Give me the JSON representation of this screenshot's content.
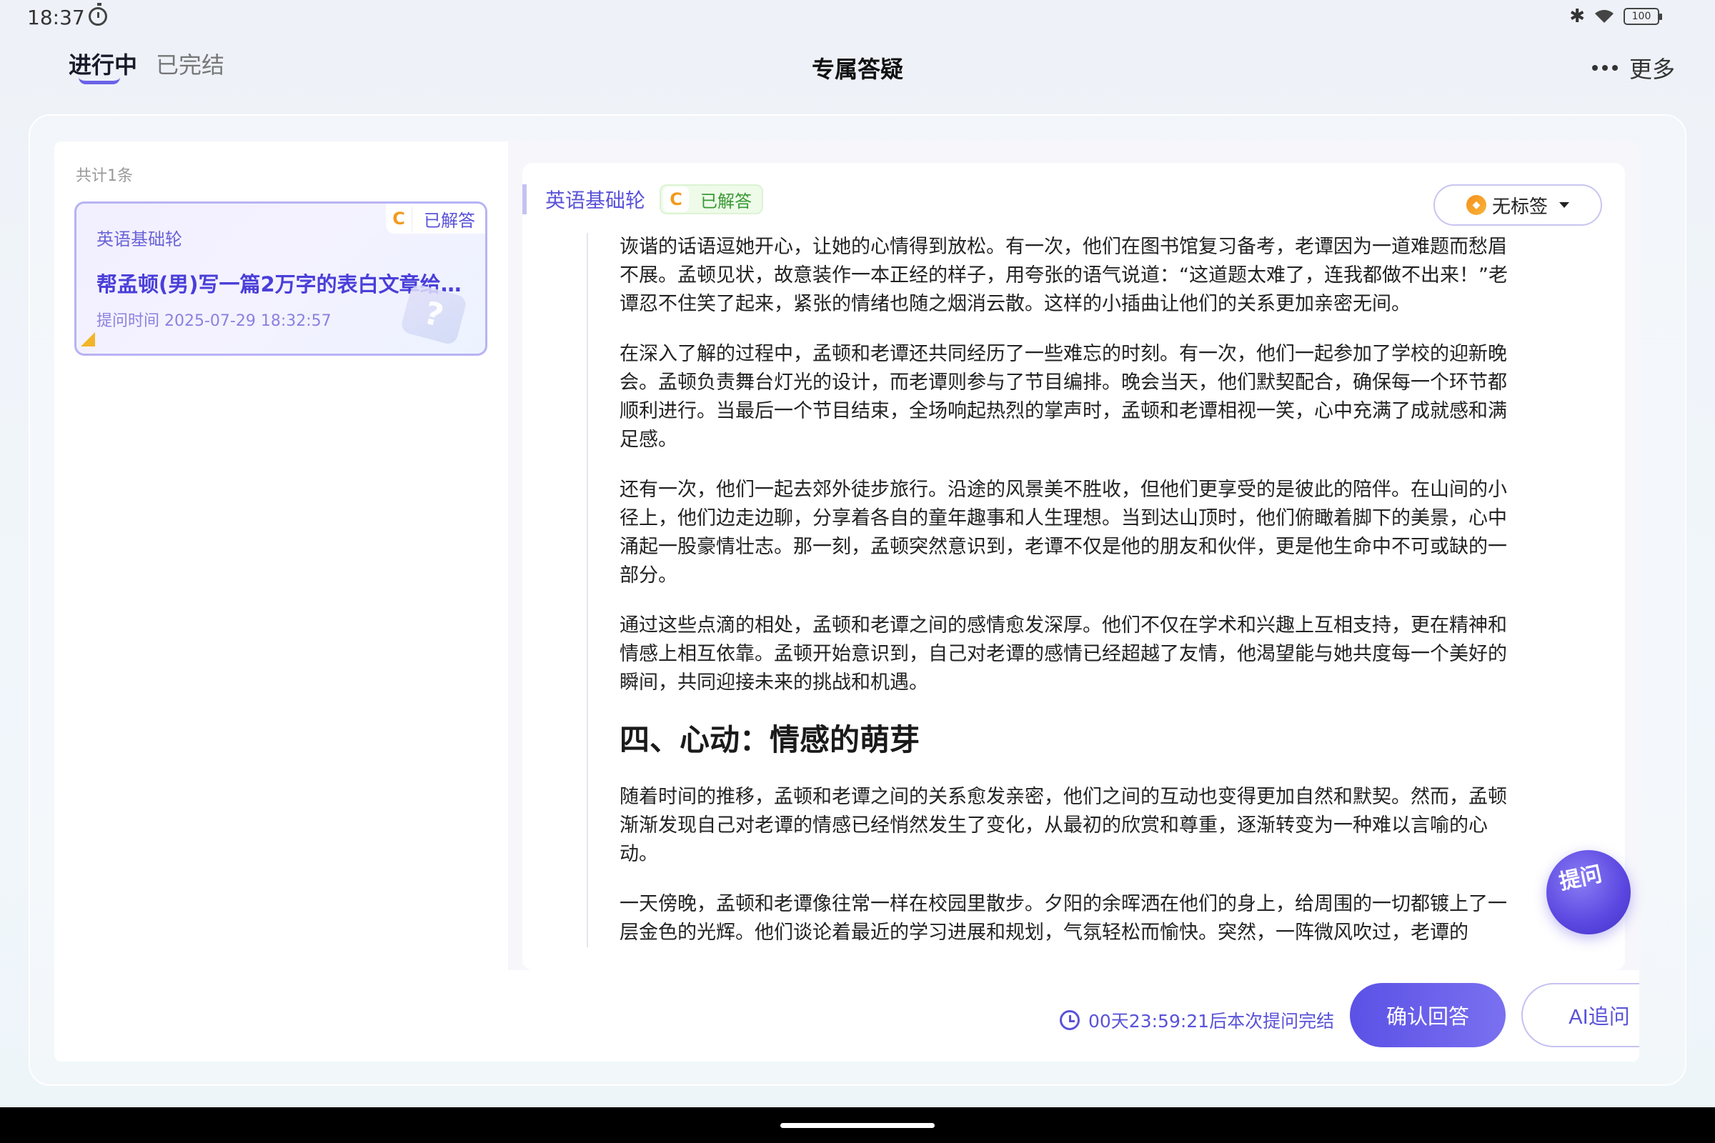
{
  "status_bar": {
    "time": "18:37",
    "battery": "100"
  },
  "header": {
    "tabs": [
      {
        "label": "进行中",
        "active": true
      },
      {
        "label": "已完结",
        "active": false
      }
    ],
    "title": "专属答疑",
    "more_label": "更多"
  },
  "list": {
    "count_label": "共计1条",
    "items": [
      {
        "course": "英语基础轮",
        "badge": "C",
        "status": "已解答",
        "title": "帮孟顿(男)写一篇2万字的表白文章给…",
        "time": "提问时间 2025-07-29 18:32:57"
      }
    ]
  },
  "answer": {
    "course": "英语基础轮",
    "badge": "C",
    "status": "已解答",
    "label_button": "无标签",
    "paragraphs": [
      "诙谐的话语逗她开心，让她的心情得到放松。有一次，他们在图书馆复习备考，老谭因为一道难题而愁眉不展。孟顿见状，故意装作一本正经的样子，用夸张的语气说道：“这道题太难了，连我都做不出来！”老谭忍不住笑了起来，紧张的情绪也随之烟消云散。这样的小插曲让他们的关系更加亲密无间。",
      "在深入了解的过程中，孟顿和老谭还共同经历了一些难忘的时刻。有一次，他们一起参加了学校的迎新晚会。孟顿负责舞台灯光的设计，而老谭则参与了节目编排。晚会当天，他们默契配合，确保每一个环节都顺利进行。当最后一个节目结束，全场响起热烈的掌声时，孟顿和老谭相视一笑，心中充满了成就感和满足感。",
      "还有一次，他们一起去郊外徒步旅行。沿途的风景美不胜收，但他们更享受的是彼此的陪伴。在山间的小径上，他们边走边聊，分享着各自的童年趣事和人生理想。当到达山顶时，他们俯瞰着脚下的美景，心中涌起一股豪情壮志。那一刻，孟顿突然意识到，老谭不仅是他的朋友和伙伴，更是他生命中不可或缺的一部分。",
      "通过这些点滴的相处，孟顿和老谭之间的感情愈发深厚。他们不仅在学术和兴趣上互相支持，更在精神和情感上相互依靠。孟顿开始意识到，自己对老谭的感情已经超越了友情，他渴望能与她共度每一个美好的瞬间，共同迎接未来的挑战和机遇。"
    ],
    "heading": "四、心动：情感的萌芽",
    "paragraphs2": [
      "随着时间的推移，孟顿和老谭之间的关系愈发亲密，他们之间的互动也变得更加自然和默契。然而，孟顿渐渐发现自己对老谭的情感已经悄然发生了变化，从最初的欣赏和尊重，逐渐转变为一种难以言喻的心动。",
      "一天傍晚，孟顿和老谭像往常一样在校园里散步。夕阳的余晖洒在他们的身上，给周围的一切都镀上了一层金色的光辉。他们谈论着最近的学习进展和规划，气氛轻松而愉快。突然，一阵微风吹过，老谭的"
    ],
    "ask_button": "提问"
  },
  "footer": {
    "countdown": "00天23:59:21后本次提问完结",
    "confirm_button": "确认回答",
    "ai_button": "AI追问"
  }
}
